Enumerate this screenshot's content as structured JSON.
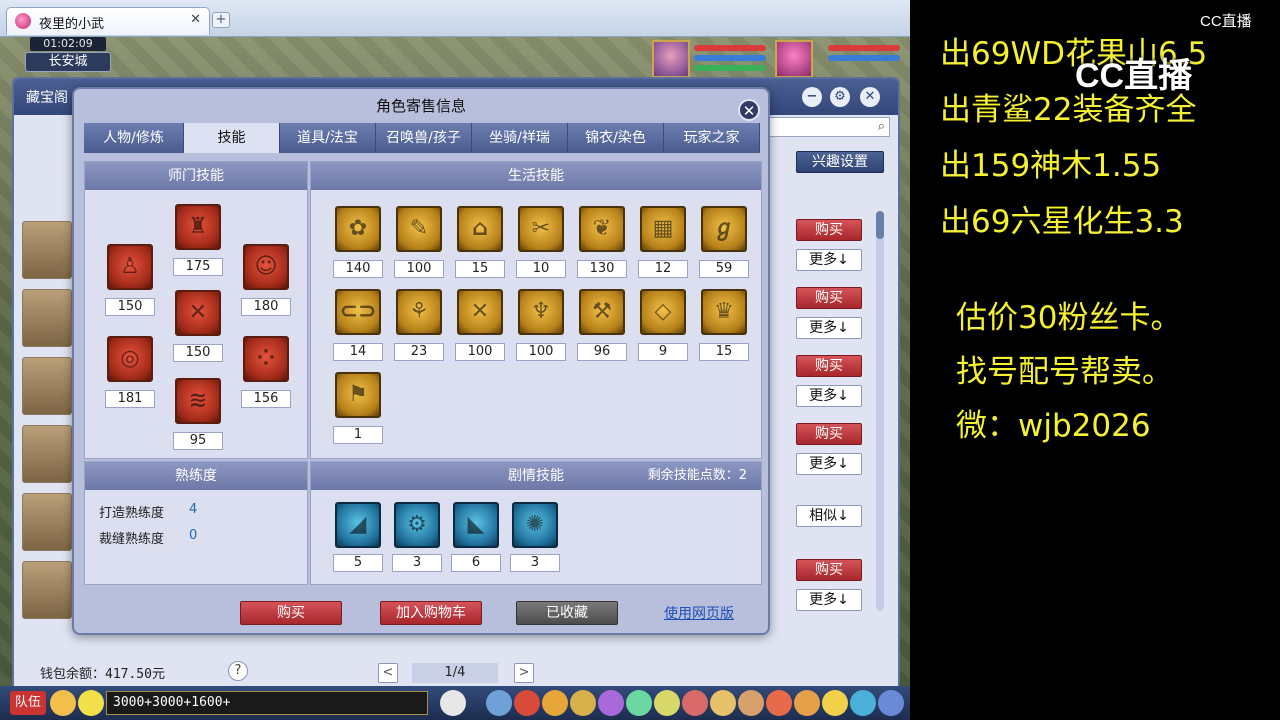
{
  "browser": {
    "tab_title": "夜里的小武",
    "tab_close": "✕",
    "new_tab": "+"
  },
  "game": {
    "clock": "01:02:09",
    "city": "长安城"
  },
  "treasure_window": {
    "title": "藏宝阁",
    "controls": [
      "−",
      "⚙",
      "✕"
    ],
    "interest_button": "兴趣设置",
    "side_buttons": [
      {
        "label": "购买",
        "kind": "buy"
      },
      {
        "label": "更多↓",
        "kind": "more"
      },
      {
        "label": "购买",
        "kind": "buy"
      },
      {
        "label": "更多↓",
        "kind": "more"
      },
      {
        "label": "购买",
        "kind": "buy"
      },
      {
        "label": "更多↓",
        "kind": "more"
      },
      {
        "label": "购买",
        "kind": "buy"
      },
      {
        "label": "更多↓",
        "kind": "more"
      },
      {
        "label": "相似↓",
        "kind": "more"
      },
      {
        "label": "购买",
        "kind": "buy"
      },
      {
        "label": "更多↓",
        "kind": "more"
      }
    ],
    "wallet": "钱包余额：417.50元",
    "help": "?",
    "page": "1/4",
    "prev": "<",
    "next": ">"
  },
  "dialog": {
    "title": "角色寄售信息",
    "close": "✕",
    "tabs": [
      {
        "label": "人物/修炼",
        "active": false
      },
      {
        "label": "技能",
        "active": true
      },
      {
        "label": "道具/法宝",
        "active": false
      },
      {
        "label": "召唤兽/孩子",
        "active": false
      },
      {
        "label": "坐骑/祥瑞",
        "active": false
      },
      {
        "label": "锦衣/染色",
        "active": false
      },
      {
        "label": "玩家之家",
        "active": false
      }
    ],
    "school_skills": {
      "heading": "师门技能",
      "levels": [
        "175",
        "150",
        "180",
        "150",
        "181",
        "156",
        "95"
      ]
    },
    "life_skills": {
      "heading": "生活技能",
      "levels": [
        "140",
        "100",
        "15",
        "10",
        "130",
        "12",
        "59",
        "14",
        "23",
        "100",
        "100",
        "96",
        "9",
        "15",
        "1"
      ]
    },
    "proficiency": {
      "heading": "熟练度",
      "items": [
        {
          "label": "打造熟练度",
          "value": "4"
        },
        {
          "label": "裁缝熟练度",
          "value": "0"
        }
      ]
    },
    "story_skills": {
      "heading": "剧情技能",
      "remaining": "剩余技能点数：2",
      "levels": [
        "5",
        "3",
        "6",
        "3"
      ]
    },
    "buttons": {
      "buy": "购买",
      "add_cart": "加入购物车",
      "collected": "已收藏",
      "web_version": "使用网页版"
    }
  },
  "bottom_bar": {
    "team": "队伍",
    "chat_input": "3000+3000+1600+"
  },
  "overlay": {
    "lines": [
      "出69WD花果山6.5",
      "出青鲨22装备齐全",
      "出159神木1.55",
      "出69六星化生3.3"
    ],
    "notes": [
      "估价30粉丝卡。",
      "找号配号帮卖。",
      "微：wjb2026"
    ],
    "logo": "CC直播",
    "logo_small": "CC直播"
  }
}
